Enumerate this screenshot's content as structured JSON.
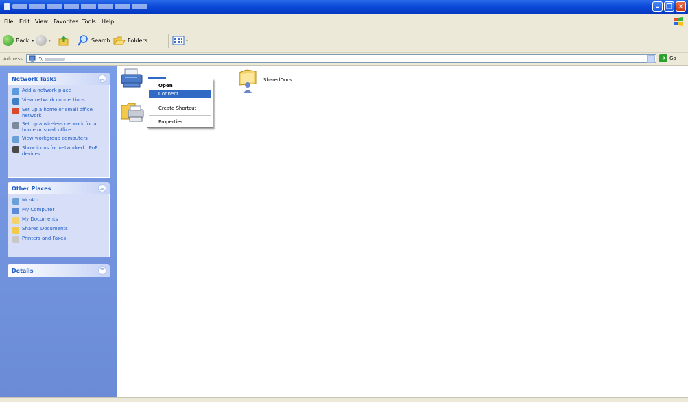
{
  "menu": [
    "File",
    "Edit",
    "View",
    "Favorites",
    "Tools",
    "Help"
  ],
  "toolbar": {
    "back_label": "Back",
    "search_label": "Search",
    "folders_label": "Folders"
  },
  "address": {
    "label": "Address",
    "value": "\\\\",
    "go_label": "Go"
  },
  "network_tasks": {
    "title": "Network Tasks",
    "items": [
      {
        "label": "Add a network place",
        "icon": "network-place-icon"
      },
      {
        "label": "View network connections",
        "icon": "network-connections-icon"
      },
      {
        "label": "Set up a home or small office network",
        "icon": "home-network-icon"
      },
      {
        "label": "Set up a wireless network for a home or small office",
        "icon": "wireless-network-icon"
      },
      {
        "label": "View workgroup computers",
        "icon": "workgroup-icon"
      },
      {
        "label": "Show icons for networked UPnP devices",
        "icon": "upnp-icon"
      }
    ]
  },
  "other_places": {
    "title": "Other Places",
    "items": [
      {
        "label": "Mc-4th",
        "icon": "workgroup-icon"
      },
      {
        "label": "My Computer",
        "icon": "computer-icon"
      },
      {
        "label": "My Documents",
        "icon": "documents-folder-icon"
      },
      {
        "label": "Shared Documents",
        "icon": "folder-icon"
      },
      {
        "label": "Printers and Faxes",
        "icon": "printer-icon"
      }
    ]
  },
  "details": {
    "title": "Details"
  },
  "items": [
    {
      "label": "SharedDocs",
      "icon": "shared-folder-icon"
    }
  ],
  "context_menu": [
    "Open",
    "Connect...",
    "Create Shortcut",
    "Properties"
  ],
  "colors": {
    "title_bar": "#0a48d8",
    "left_pane": "#7b9de8",
    "selection": "#316ac5",
    "link": "#215dc6"
  }
}
